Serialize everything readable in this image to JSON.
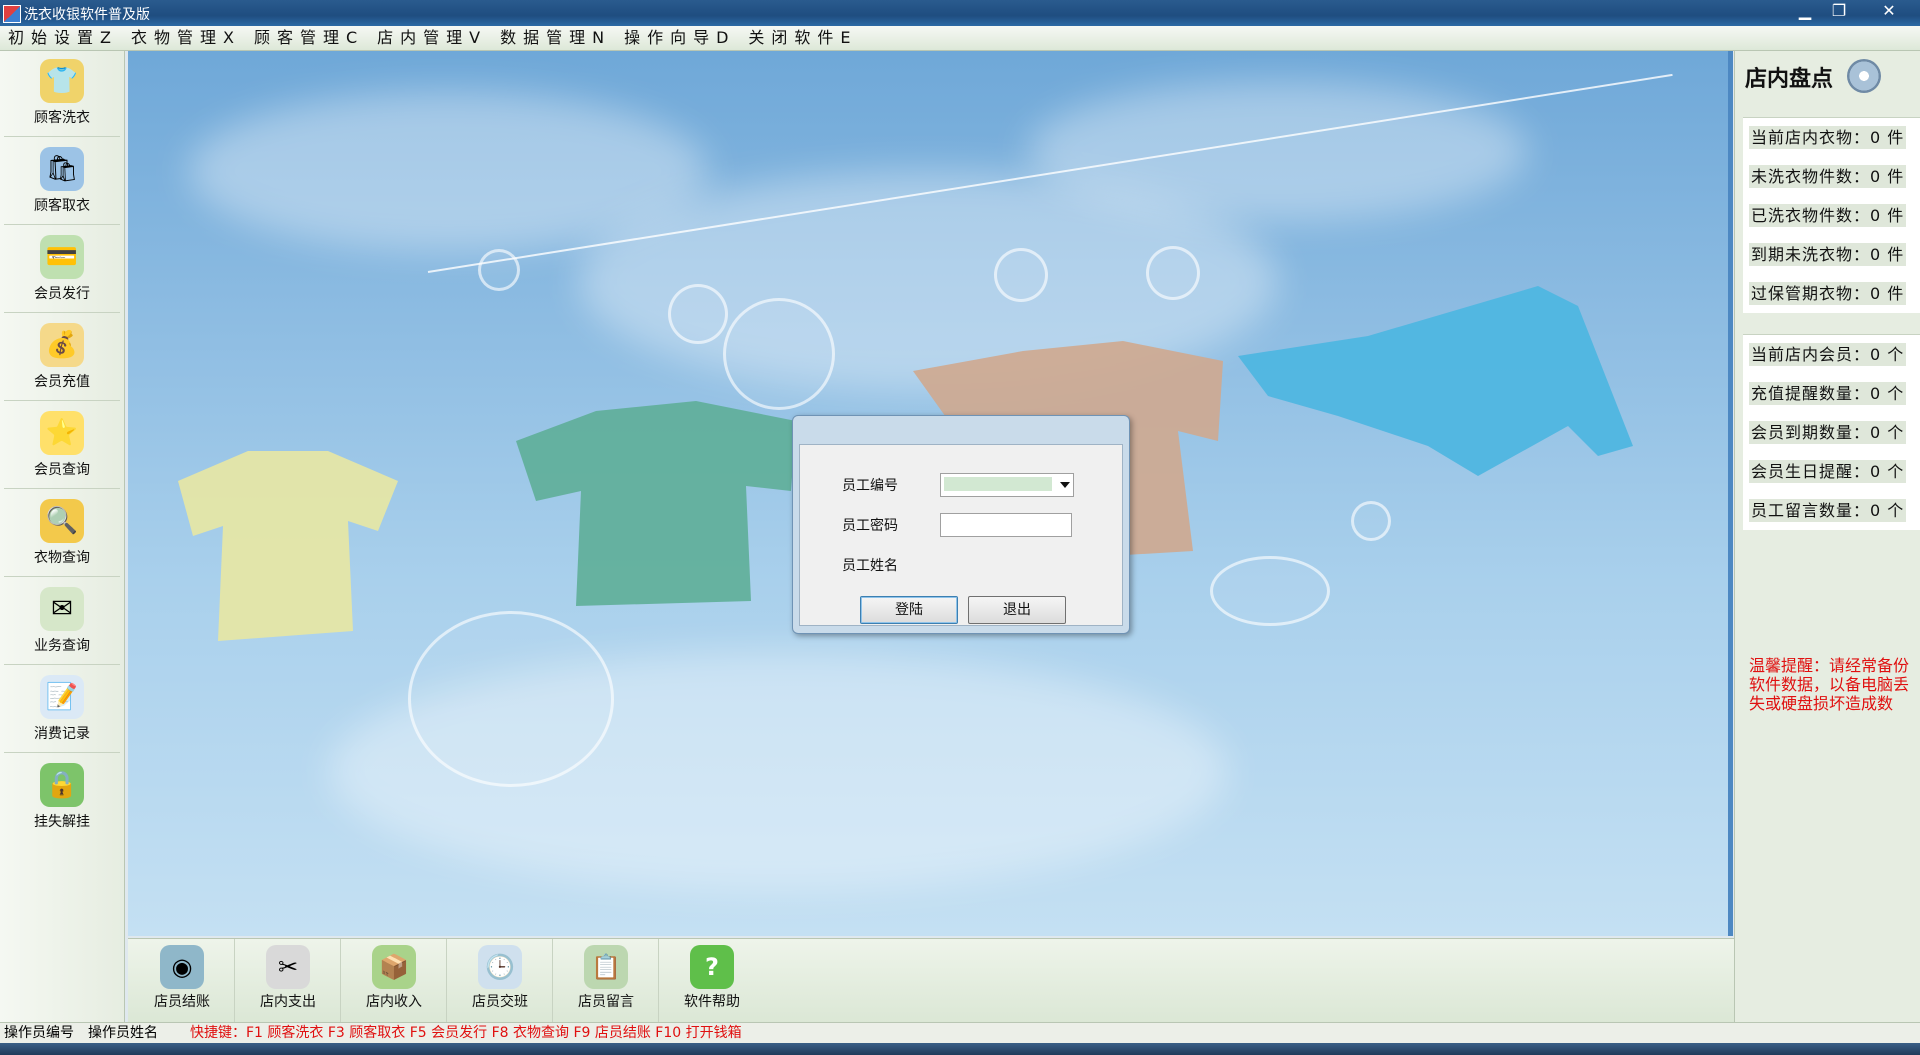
{
  "window": {
    "title": "洗衣收银软件普及版",
    "min": "▁",
    "max": "❐",
    "close": "✕"
  },
  "menu": [
    "初始设置Z",
    "衣物管理X",
    "顾客管理C",
    "店内管理V",
    "数据管理N",
    "操作向导D",
    "关闭软件E"
  ],
  "sidebar": [
    {
      "label": "顾客洗衣",
      "icon": "shirt-icon"
    },
    {
      "label": "顾客取衣",
      "icon": "bag-icon"
    },
    {
      "label": "会员发行",
      "icon": "card-icon"
    },
    {
      "label": "会员充值",
      "icon": "coins-icon"
    },
    {
      "label": "会员查询",
      "icon": "star-icon"
    },
    {
      "label": "衣物查询",
      "icon": "magnifier-icon"
    },
    {
      "label": "业务查询",
      "icon": "envelope-icon"
    },
    {
      "label": "消费记录",
      "icon": "notebook-icon"
    },
    {
      "label": "挂失解挂",
      "icon": "lock-icon"
    }
  ],
  "bottom": [
    {
      "label": "店员结账",
      "icon": "disc-icon"
    },
    {
      "label": "店内支出",
      "icon": "scissors-icon"
    },
    {
      "label": "店内收入",
      "icon": "box-icon"
    },
    {
      "label": "店员交班",
      "icon": "clock-icon"
    },
    {
      "label": "店员留言",
      "icon": "memo-icon"
    },
    {
      "label": "软件帮助",
      "icon": "help-icon"
    }
  ],
  "login": {
    "emp_id_label": "员工编号",
    "emp_pwd_label": "员工密码",
    "emp_name_label": "员工姓名",
    "login_button": "登陆",
    "exit_button": "退出"
  },
  "right_panel": {
    "title": "店内盘点",
    "stock": [
      "当前店内衣物：0 件",
      "未洗衣物件数：0 件",
      "已洗衣物件数：0 件",
      "到期未洗衣物：0 件",
      "过保管期衣物：0 件"
    ],
    "members": [
      "当前店内会员：0 个",
      "充值提醒数量：0 个",
      "会员到期数量：0 个",
      "会员生日提醒：0 个",
      "员工留言数量：0 个"
    ],
    "tip": "温馨提醒：请经常备份软件数据，以备电脑丢失或硬盘损坏造成数"
  },
  "status": {
    "operator_id_label": "操作员编号",
    "operator_name_label": "操作员姓名",
    "shortcuts": "快捷键：F1 顾客洗衣  F3 顾客取衣 F5 会员发行 F8 衣物查询   F9 店员结账  F10 打开钱箱"
  },
  "colors": {
    "accent": "#4d88c2",
    "tip_red": "#e01010",
    "panel_bg": "#e6ede1"
  }
}
